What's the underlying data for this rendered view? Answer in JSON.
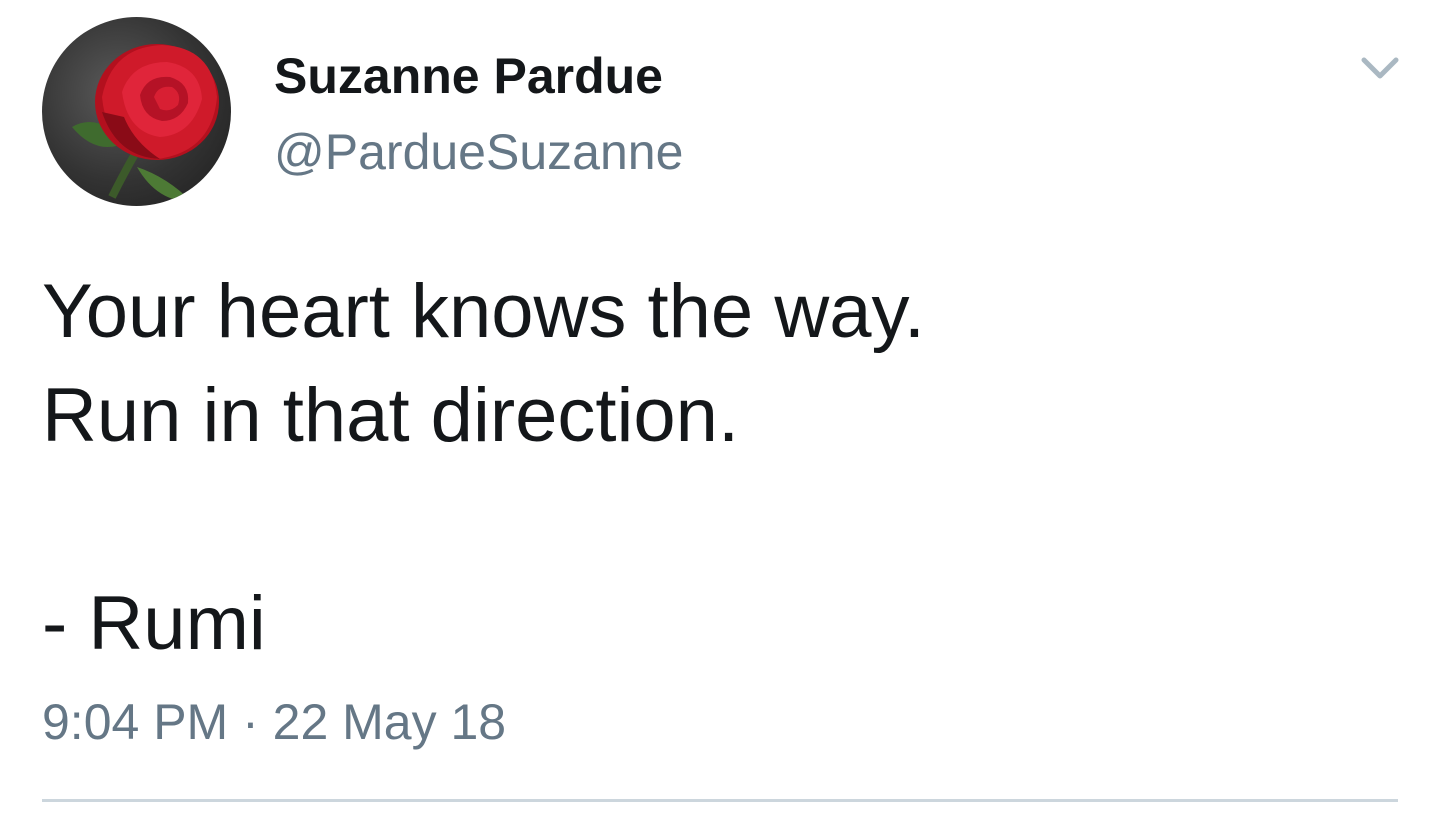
{
  "author": {
    "display_name": "Suzanne Pardue",
    "handle": "@PardueSuzanne",
    "avatar_icon": "red-rose-avatar"
  },
  "tweet": {
    "text": "Your heart knows the way.\nRun in that direction.\n\n- Rumi",
    "timestamp": "9:04 PM · 22 May 18"
  },
  "menu": {
    "icon": "chevron-down-icon"
  },
  "colors": {
    "text_primary": "#14171a",
    "text_secondary": "#657786",
    "divider": "#ccd6dd",
    "caret": "#aab8c2"
  }
}
